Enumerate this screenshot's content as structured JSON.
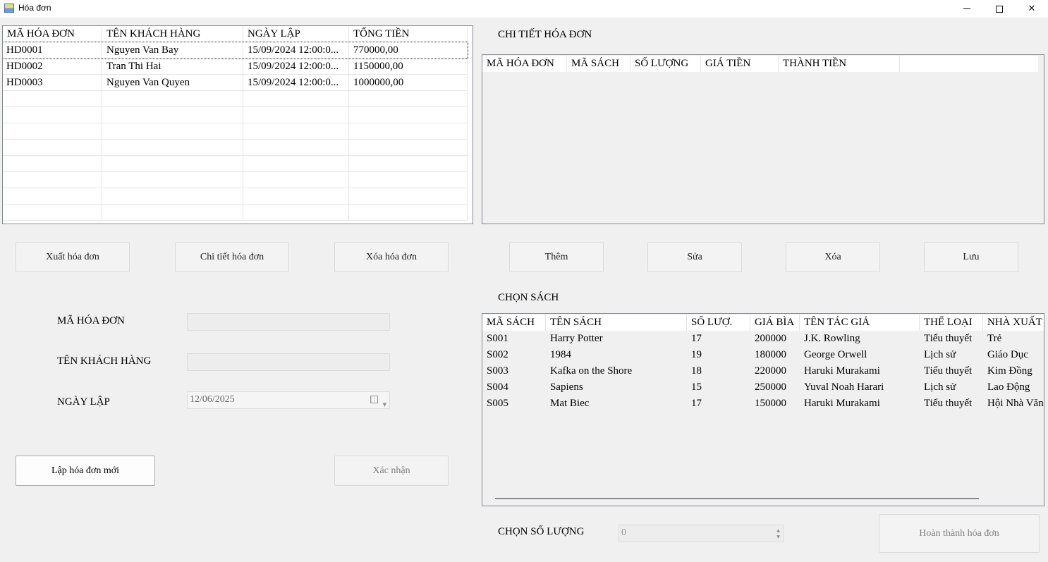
{
  "window": {
    "title": "Hóa đơn",
    "minimize": "—",
    "close": "✕"
  },
  "invoice_grid": {
    "columns": [
      "MÃ HÓA ĐƠN",
      "TÊN KHÁCH HÀNG",
      "NGÀY LẬP",
      "TỔNG TIỀN"
    ],
    "rows": [
      [
        "HD0001",
        "Nguyen Van Bay",
        "15/09/2024 12:00:0...",
        "770000,00"
      ],
      [
        "HD0002",
        "Tran Thi Hai",
        "15/09/2024 12:00:0...",
        "1150000,00"
      ],
      [
        "HD0003",
        "Nguyen Van Quyen",
        "15/09/2024 12:00:0...",
        "1000000,00"
      ]
    ]
  },
  "invoice_buttons": {
    "export": "Xuất hóa đơn",
    "detail": "Chi tiết hóa đơn",
    "delete": "Xóa hóa đơn"
  },
  "form": {
    "invoice_id_label": "MÃ HÓA ĐƠN",
    "invoice_id_value": "",
    "customer_label": "TÊN KHÁCH HÀNG",
    "customer_value": "",
    "date_label": "NGÀY LẬP",
    "date_value": "12/06/2025",
    "new_invoice": "Lập hóa đơn mới",
    "confirm": "Xác nhận"
  },
  "detail": {
    "title": "CHI TIẾT HÓA ĐƠN",
    "columns": [
      "MÃ HÓA ĐƠN",
      "MÃ SÁCH",
      "SỐ LƯỢNG",
      "GIÁ TIỀN",
      "THÀNH TIỀN"
    ],
    "add": "Thêm",
    "edit": "Sửa",
    "delete": "Xóa",
    "save": "Lưu"
  },
  "books": {
    "title": "CHỌN SÁCH",
    "columns": [
      "MÃ SÁCH",
      "TÊN SÁCH",
      "SỐ LƯỢ.",
      "GIÁ BÌA",
      "TÊN TÁC GIẢ",
      "THỂ LOẠI",
      "NHÀ XUẤT"
    ],
    "rows": [
      [
        "S001",
        "Harry Potter",
        "17",
        "200000",
        "J.K. Rowling",
        "Tiểu thuyết",
        "Trẻ"
      ],
      [
        "S002",
        "1984",
        "19",
        "180000",
        "George Orwell",
        "Lịch sử",
        "Giáo Dục"
      ],
      [
        "S003",
        "Kafka on the Shore",
        "18",
        "220000",
        "Haruki Murakami",
        "Tiểu thuyết",
        "Kim Đồng"
      ],
      [
        "S004",
        "Sapiens",
        "15",
        "250000",
        "Yuval Noah Harari",
        "Lịch sử",
        "Lao Động"
      ],
      [
        "S005",
        "Mat Biec",
        "17",
        "150000",
        "Haruki Murakami",
        "Tiểu thuyết",
        "Hội Nhà Văn"
      ]
    ]
  },
  "quantity": {
    "label": "CHỌN SỐ LƯỢNG",
    "value": "0",
    "complete": "Hoàn thành hóa đơn"
  }
}
